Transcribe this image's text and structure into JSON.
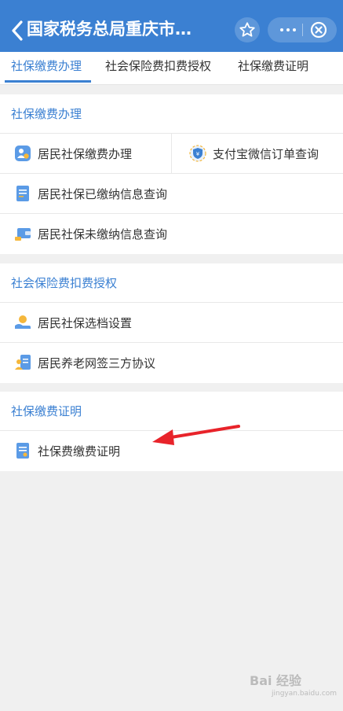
{
  "header": {
    "title": "国家税务总局重庆市…"
  },
  "tabs": [
    {
      "label": "社保缴费办理",
      "active": true
    },
    {
      "label": "社会保险费扣费授权",
      "active": false
    },
    {
      "label": "社保缴费证明",
      "active": false
    }
  ],
  "sections": [
    {
      "title": "社保缴费办理",
      "items": [
        {
          "label": "居民社保缴费办理",
          "icon": "person-payment-icon"
        },
        {
          "label": "支付宝微信订单查询",
          "icon": "shield-search-icon"
        },
        {
          "label": "居民社保已缴纳信息查询",
          "icon": "document-list-icon"
        },
        {
          "label": "居民社保未缴纳信息查询",
          "icon": "wallet-icon"
        }
      ]
    },
    {
      "title": "社会保险费扣费授权",
      "items": [
        {
          "label": "居民社保选档设置",
          "icon": "hand-coin-icon"
        },
        {
          "label": "居民养老网签三方协议",
          "icon": "person-document-icon"
        }
      ]
    },
    {
      "title": "社保缴费证明",
      "items": [
        {
          "label": "社保费缴费证明",
          "icon": "certificate-icon"
        }
      ]
    }
  ],
  "watermark": {
    "text": "Bai 经验",
    "sub": "jingyan.baidu.com"
  },
  "colors": {
    "brand": "#3b80d2",
    "annotation_arrow": "#e8232a"
  }
}
